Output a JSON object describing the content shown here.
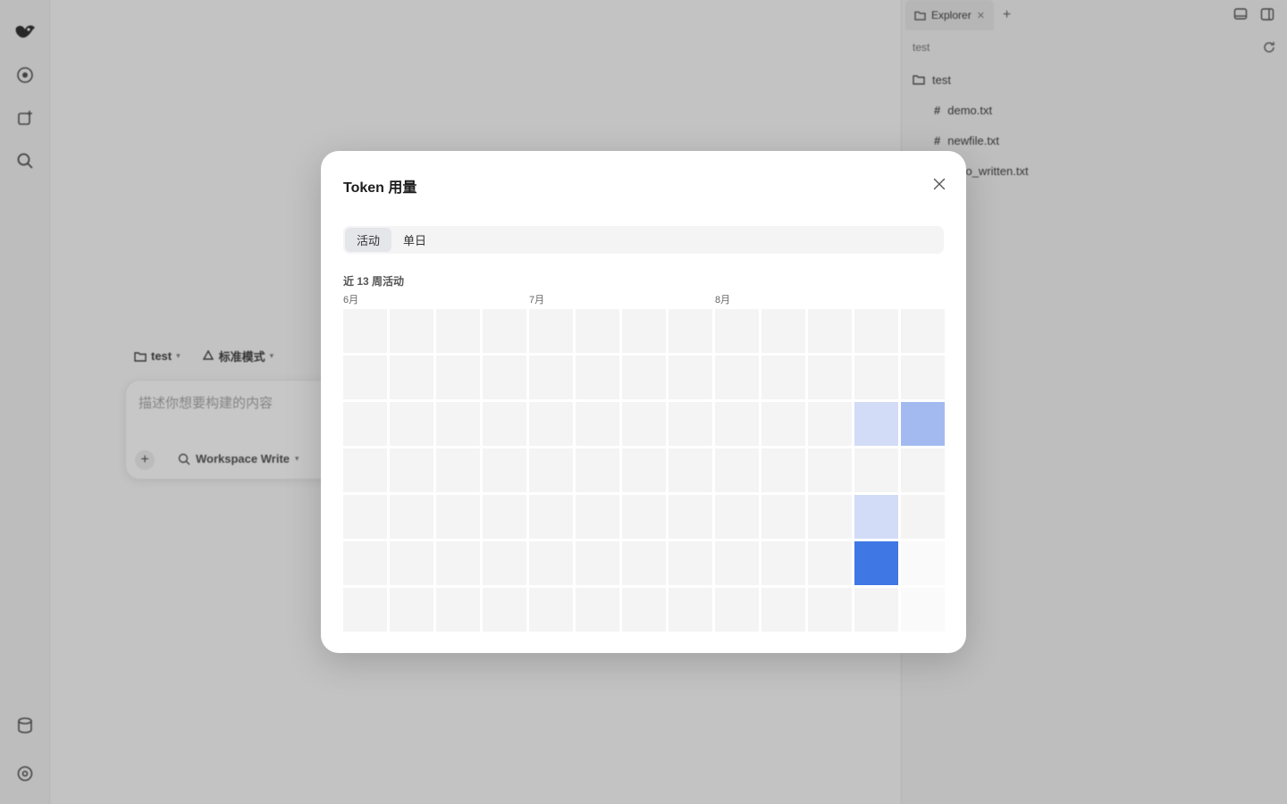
{
  "background": {
    "right_panel": {
      "tab_label": "Explorer",
      "explorer_title": "test",
      "tree": {
        "root": "test",
        "files": [
          "demo.txt",
          "newfile.txt",
          "hello_written.txt"
        ]
      }
    },
    "composer": {
      "project": "test",
      "mode": "标准模式",
      "placeholder": "描述你想要构建的内容",
      "permission": "Workspace Write"
    }
  },
  "modal": {
    "title": "Token 用量",
    "tabs": [
      {
        "label": "活动",
        "active": true
      },
      {
        "label": "单日",
        "active": false
      }
    ],
    "section_label": "近 13 周活动",
    "months": [
      {
        "label": "6月",
        "week_index": 0
      },
      {
        "label": "7月",
        "week_index": 4
      },
      {
        "label": "8月",
        "week_index": 8
      }
    ]
  },
  "heatmap": {
    "weeks": 13,
    "days": 7,
    "level_colors": {
      "0": "#f4f4f4",
      "1": "#d2dcf6",
      "2": "#a3baf0",
      "4": "#3f77e4",
      "future": "#fafafa"
    },
    "active_cells": [
      {
        "week": 11,
        "day": 2,
        "level": 1
      },
      {
        "week": 12,
        "day": 2,
        "level": 2
      },
      {
        "week": 11,
        "day": 4,
        "level": 1
      },
      {
        "week": 11,
        "day": 5,
        "level": 4
      }
    ],
    "future_cells": [
      {
        "week": 12,
        "day": 5
      },
      {
        "week": 12,
        "day": 6
      }
    ]
  }
}
